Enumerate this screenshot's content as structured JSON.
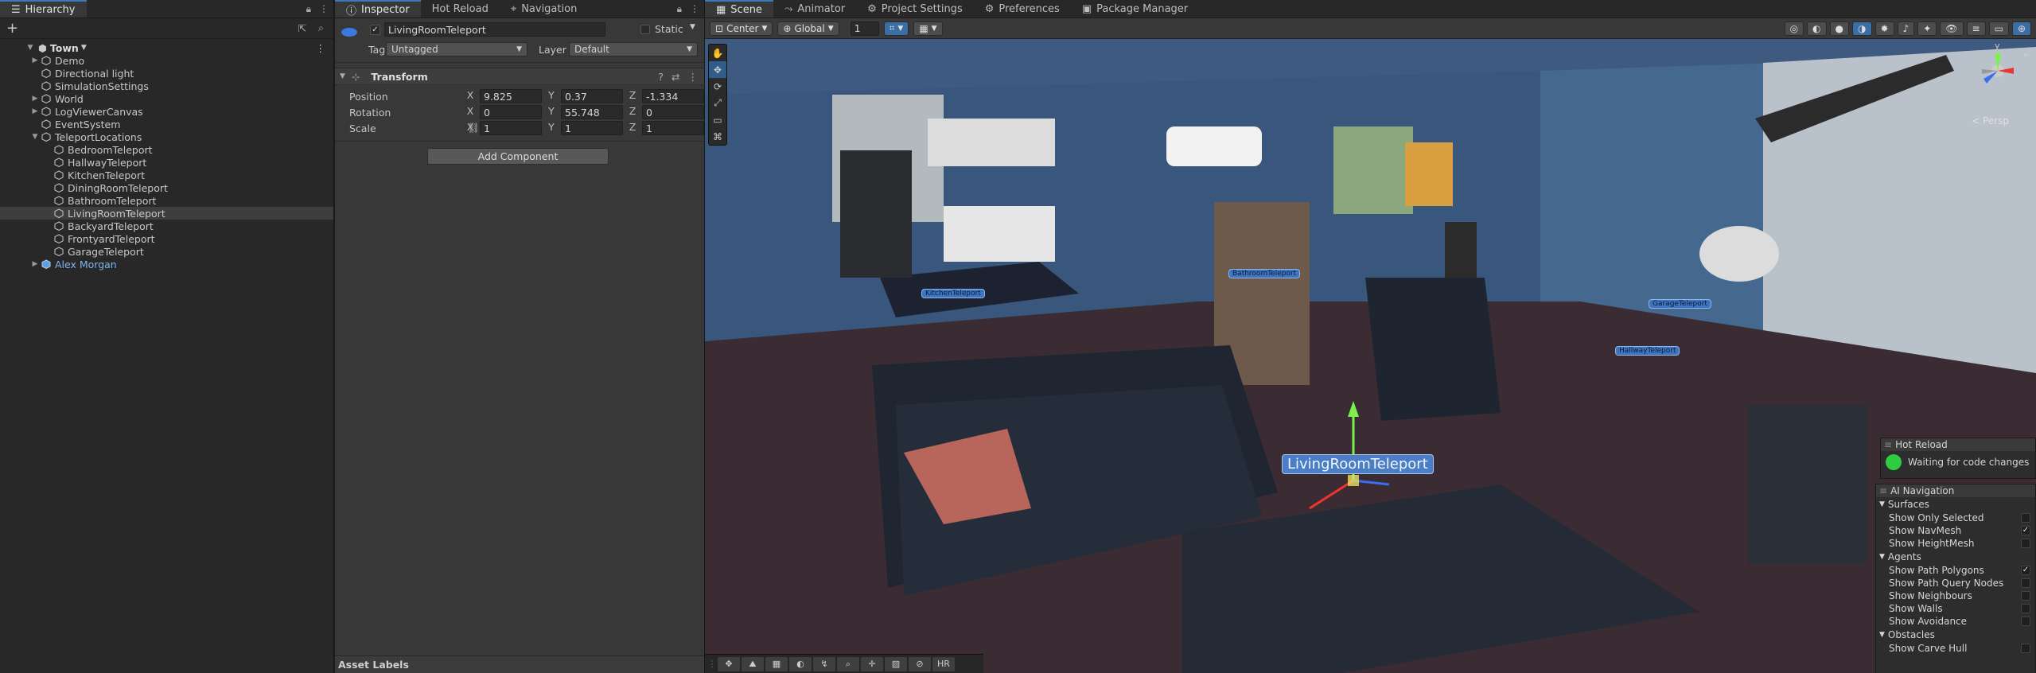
{
  "hierarchy": {
    "tab_label": "Hierarchy",
    "add_label": "+",
    "root": "Town",
    "items": [
      {
        "label": "Demo",
        "indent": 1,
        "expandable": true
      },
      {
        "label": "Directional light",
        "indent": 1,
        "expandable": false
      },
      {
        "label": "SimulationSettings",
        "indent": 1,
        "expandable": false
      },
      {
        "label": "World",
        "indent": 1,
        "expandable": true
      },
      {
        "label": "LogViewerCanvas",
        "indent": 1,
        "expandable": true
      },
      {
        "label": "EventSystem",
        "indent": 1,
        "expandable": false
      },
      {
        "label": "TeleportLocations",
        "indent": 1,
        "expandable": true,
        "expanded": true
      },
      {
        "label": "BedroomTeleport",
        "indent": 2,
        "expandable": false
      },
      {
        "label": "HallwayTeleport",
        "indent": 2,
        "expandable": false
      },
      {
        "label": "KitchenTeleport",
        "indent": 2,
        "expandable": false
      },
      {
        "label": "DiningRoomTeleport",
        "indent": 2,
        "expandable": false
      },
      {
        "label": "BathroomTeleport",
        "indent": 2,
        "expandable": false
      },
      {
        "label": "LivingRoomTeleport",
        "indent": 2,
        "expandable": false,
        "selected": true
      },
      {
        "label": "BackyardTeleport",
        "indent": 2,
        "expandable": false
      },
      {
        "label": "FrontyardTeleport",
        "indent": 2,
        "expandable": false
      },
      {
        "label": "GarageTeleport",
        "indent": 2,
        "expandable": false
      },
      {
        "label": "Alex Morgan",
        "indent": 1,
        "expandable": true,
        "prefab": true
      }
    ]
  },
  "inspector": {
    "tabs": [
      "Inspector",
      "Hot Reload",
      "Navigation"
    ],
    "object_name": "LivingRoomTeleport",
    "static_label": "Static",
    "tag_label": "Tag",
    "tag_value": "Untagged",
    "layer_label": "Layer",
    "layer_value": "Default",
    "transform": {
      "title": "Transform",
      "position_label": "Position",
      "rotation_label": "Rotation",
      "scale_label": "Scale",
      "position": {
        "x": "9.825",
        "y": "0.37",
        "z": "-1.334"
      },
      "rotation": {
        "x": "0",
        "y": "55.748",
        "z": "0"
      },
      "scale": {
        "x": "1",
        "y": "1",
        "z": "1"
      }
    },
    "add_component_label": "Add Component",
    "asset_labels": "Asset Labels"
  },
  "scene": {
    "tabs": [
      "Scene",
      "Animator",
      "Project Settings",
      "Preferences",
      "Package Manager"
    ],
    "toolbar": {
      "pivot": "Center",
      "space": "Global",
      "snap_value": "1"
    },
    "persp_label": "< Persp",
    "gizmo_axis": "y",
    "labels": {
      "kitchen": "KitchenTeleport",
      "bathroom": "BathroomTeleport",
      "garage": "GarageTeleport",
      "hallway": "HallwayTeleport",
      "living": "LivingRoomTeleport"
    },
    "hot_reload": {
      "title": "Hot Reload",
      "status": "Waiting for code changes"
    },
    "ai_nav": {
      "title": "AI Navigation",
      "surfaces_label": "Surfaces",
      "surfaces": [
        {
          "label": "Show Only Selected",
          "checked": false
        },
        {
          "label": "Show NavMesh",
          "checked": true
        },
        {
          "label": "Show HeightMesh",
          "checked": false
        }
      ],
      "agents_label": "Agents",
      "agents": [
        {
          "label": "Show Path Polygons",
          "checked": true
        },
        {
          "label": "Show Path Query Nodes",
          "checked": false
        },
        {
          "label": "Show Neighbours",
          "checked": false
        },
        {
          "label": "Show Walls",
          "checked": false
        },
        {
          "label": "Show Avoidance",
          "checked": false
        }
      ],
      "obstacles_label": "Obstacles",
      "obstacles": [
        {
          "label": "Show Carve Hull",
          "checked": false
        }
      ]
    },
    "bottom_hr": "HR"
  },
  "colors": {
    "accent": "#3a79bb",
    "selection": "#3e74c0",
    "hot_reload_dot": "#2ecc40"
  }
}
